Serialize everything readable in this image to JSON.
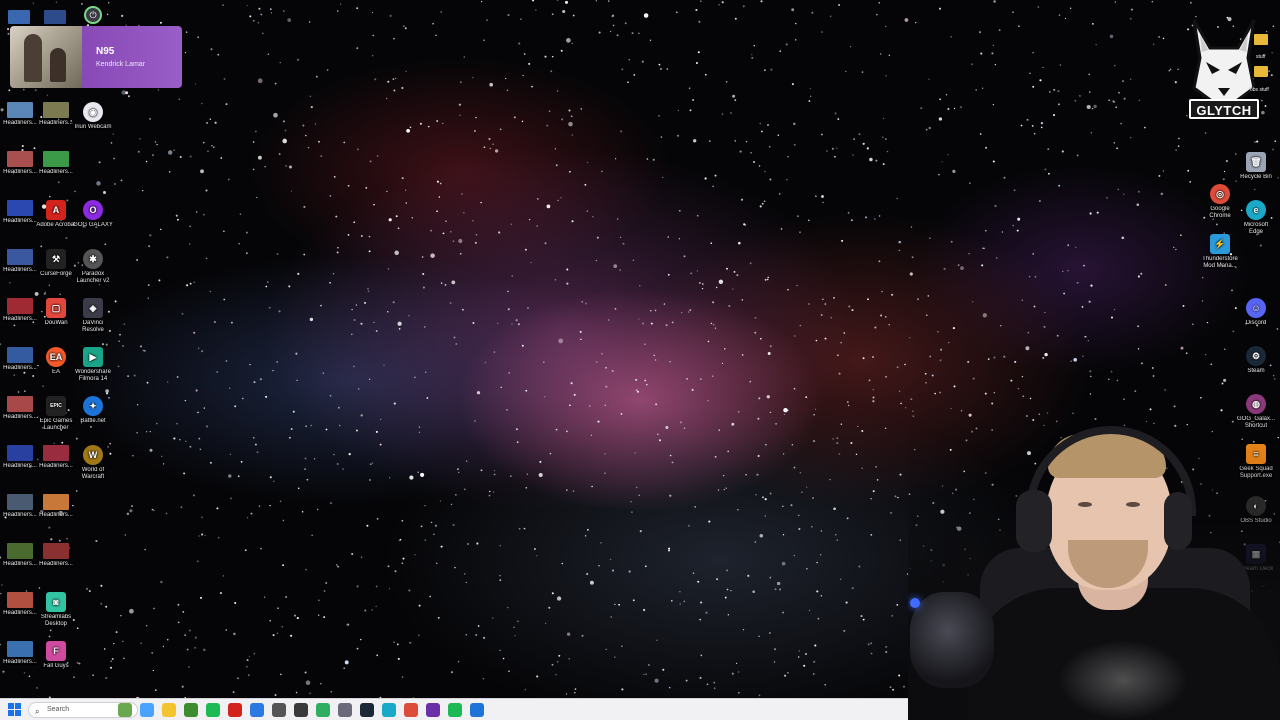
{
  "media": {
    "title": "N95",
    "artist": "Kendrick Lamar"
  },
  "logo": {
    "text": "GLYTCH"
  },
  "desktop_left": [
    {
      "label": "Headliners...",
      "kind": "thumb",
      "color": "#5a86b8"
    },
    {
      "label": "Headliners...",
      "kind": "thumb",
      "color": "#7b7a50"
    },
    {
      "label": "Iriun Webcam",
      "kind": "round",
      "color": "#e8e8ee",
      "glyph": "◉"
    },
    {
      "label": "Headliners...",
      "kind": "thumb",
      "color": "#a85050"
    },
    {
      "label": "Headliners...",
      "kind": "thumb",
      "color": "#3a9a48"
    },
    {
      "label": "Headliners...",
      "kind": "thumb",
      "color": "#2b48b0"
    },
    {
      "label": "Adobe Acrobat",
      "kind": "app",
      "color": "#d2231c",
      "glyph": "A"
    },
    {
      "label": "GOG GALAXY",
      "kind": "round",
      "color": "#8a2be2",
      "glyph": "O"
    },
    {
      "label": "Headliners...",
      "kind": "thumb",
      "color": "#3a58a0"
    },
    {
      "label": "CurseForge",
      "kind": "app",
      "color": "#222",
      "glyph": "⚒"
    },
    {
      "label": "Paradox Launcher v2",
      "kind": "round",
      "color": "#555",
      "glyph": "✱"
    },
    {
      "label": "Headliners...",
      "kind": "thumb",
      "color": "#a02a34"
    },
    {
      "label": "DouWan",
      "kind": "app",
      "color": "#e2473b",
      "glyph": "▢"
    },
    {
      "label": "DaVinci Resolve",
      "kind": "app",
      "color": "#3b3b4a",
      "glyph": "◈"
    },
    {
      "label": "Headliners...",
      "kind": "thumb",
      "color": "#345ba0"
    },
    {
      "label": "EA",
      "kind": "round",
      "color": "#f25a2a",
      "glyph": "EA"
    },
    {
      "label": "Wondershare Filmora 14",
      "kind": "app",
      "color": "#1aa58a",
      "glyph": "▶"
    },
    {
      "label": "Headliners...",
      "kind": "thumb",
      "color": "#a84848"
    },
    {
      "label": "Epic Games Launcher",
      "kind": "app",
      "color": "#222",
      "glyph": "EPIC"
    },
    {
      "label": "Battle.net",
      "kind": "round",
      "color": "#1d74d8",
      "glyph": "✦"
    },
    {
      "label": "Headliners...",
      "kind": "thumb",
      "color": "#2a40a0"
    },
    {
      "label": "Headliners...",
      "kind": "thumb",
      "color": "#9a2c40"
    },
    {
      "label": "World of Warcraft",
      "kind": "round",
      "color": "#a07818",
      "glyph": "W"
    },
    {
      "label": "Headliners...",
      "kind": "thumb",
      "color": "#4a5a70"
    },
    {
      "label": "Headliners...",
      "kind": "thumb",
      "color": "#c87838"
    },
    {
      "label": "Headliners...",
      "kind": "thumb",
      "color": "#4a6a30"
    },
    {
      "label": "Headliners...",
      "kind": "thumb",
      "color": "#8a3030"
    },
    {
      "label": "Headliners...",
      "kind": "thumb",
      "color": "#b05040"
    },
    {
      "label": "Streamlabs Desktop",
      "kind": "app",
      "color": "#31c3a2",
      "glyph": "◙"
    },
    {
      "label": "Headliners...",
      "kind": "thumb",
      "color": "#3a70b0"
    },
    {
      "label": "Fall Guys",
      "kind": "app",
      "color": "#d04aa0",
      "glyph": "F"
    }
  ],
  "desktop_right": [
    {
      "label": "Recycle Bin",
      "kind": "app",
      "color": "#9aa4b4",
      "glyph": "🗑"
    },
    {
      "label": "Google Chrome",
      "kind": "round",
      "color": "#dd4b39",
      "glyph": "◎"
    },
    {
      "label": "Microsoft Edge",
      "kind": "round",
      "color": "#1aa9c6",
      "glyph": "e"
    },
    {
      "label": "Thunderstore Mod Mana...",
      "kind": "app",
      "color": "#2a9ad8",
      "glyph": "⚡"
    },
    {
      "label": "Discord",
      "kind": "round",
      "color": "#5865f2",
      "glyph": "☺"
    },
    {
      "label": "Steam",
      "kind": "round",
      "color": "#1b2838",
      "glyph": "⚙"
    },
    {
      "label": "GOG_Galax... Shortcut",
      "kind": "round",
      "color": "#8a3a7a",
      "glyph": "◍"
    },
    {
      "label": "Geek Squad Support.exe",
      "kind": "app",
      "color": "#f28a1a",
      "glyph": "≡"
    },
    {
      "label": "OBS Studio",
      "kind": "round",
      "color": "#303030",
      "glyph": "◐"
    },
    {
      "label": "Stream Deck",
      "kind": "app",
      "color": "#1a1a3a",
      "glyph": "▦"
    }
  ],
  "folders": {
    "f1": "stuff",
    "f2": "obs stuff"
  },
  "taskbar": {
    "search_placeholder": "Search",
    "apps": [
      {
        "name": "widgets-app-icon",
        "color": "#6aa84f"
      },
      {
        "name": "copilot-app-icon",
        "color": "#4aa3ff"
      },
      {
        "name": "file-explorer-app-icon",
        "color": "#f4c430"
      },
      {
        "name": "minecraft-app-icon",
        "color": "#3d8c2e"
      },
      {
        "name": "xbox-app-icon",
        "color": "#1db954"
      },
      {
        "name": "acrobat-app-icon",
        "color": "#d2231c"
      },
      {
        "name": "store-app-icon",
        "color": "#2a7ae2"
      },
      {
        "name": "settings-app-icon",
        "color": "#555555"
      },
      {
        "name": "game-app-icon",
        "color": "#3a3a3a"
      },
      {
        "name": "greenshot-app-icon",
        "color": "#2fae62"
      },
      {
        "name": "paradox-app-icon",
        "color": "#6a6a7a"
      },
      {
        "name": "steam-app-icon",
        "color": "#1b2838"
      },
      {
        "name": "edge-app-icon",
        "color": "#1aa9c6"
      },
      {
        "name": "chrome-app-icon",
        "color": "#dd4b39"
      },
      {
        "name": "obs-app-icon",
        "color": "#6b2fa8"
      },
      {
        "name": "spotify-app-icon",
        "color": "#1db954"
      },
      {
        "name": "battlenet-app-icon",
        "color": "#1d74d8"
      }
    ]
  }
}
